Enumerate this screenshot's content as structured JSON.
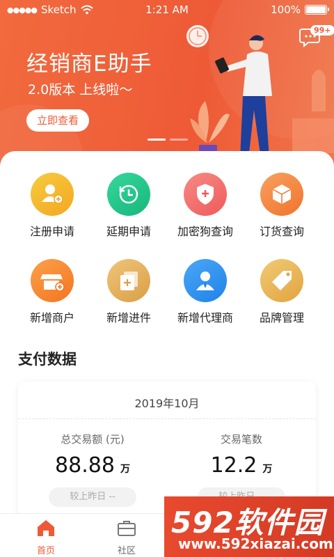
{
  "status_bar": {
    "carrier": "Sketch",
    "time": "1:21 AM",
    "battery": "100%"
  },
  "banner": {
    "title": "经销商E助手",
    "subtitle": "2.0版本 上线啦～",
    "button_label": "立即查看",
    "message_badge": "99+",
    "slides": 2,
    "active_slide": 1
  },
  "functions": [
    {
      "label": "注册申请",
      "icon": "user-add-icon",
      "color": "#f5b62a"
    },
    {
      "label": "延期申请",
      "icon": "clock-renew-icon",
      "color": "#22c58a"
    },
    {
      "label": "加密狗查询",
      "icon": "shield-plus-icon",
      "color": "#f26e6e"
    },
    {
      "label": "订货查询",
      "icon": "box-icon",
      "color": "#f5803e"
    },
    {
      "label": "新增商户",
      "icon": "store-add-icon",
      "color": "#f7862e"
    },
    {
      "label": "新增进件",
      "icon": "doc-add-icon",
      "color": "#e6b25a"
    },
    {
      "label": "新增代理商",
      "icon": "agent-icon",
      "color": "#2a93f0"
    },
    {
      "label": "品牌管理",
      "icon": "tag-icon",
      "color": "#e8b550"
    }
  ],
  "payment": {
    "section_title": "支付数据",
    "date": "2019年10月",
    "total_label": "总交易额 (元)",
    "total_value": "88.88",
    "total_unit": "万",
    "count_label": "交易笔数",
    "count_value": "12.2",
    "count_unit": "万",
    "compare_label": "较上昨日 --"
  },
  "tabs": [
    {
      "label": "首页",
      "icon": "home-icon",
      "active": true
    },
    {
      "label": "社区",
      "icon": "briefcase-icon",
      "active": false
    }
  ],
  "watermark": {
    "brand": "592软件园",
    "url": "www.592xiazai.com"
  },
  "colors": {
    "accent": "#ef5a36"
  }
}
